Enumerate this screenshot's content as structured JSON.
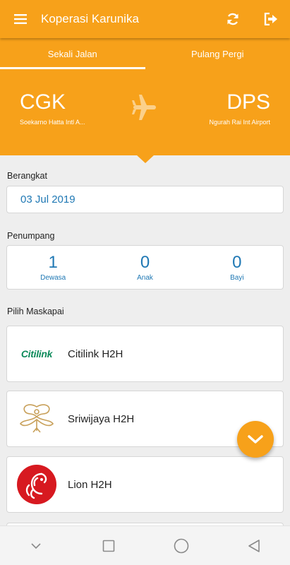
{
  "appbar": {
    "title": "Koperasi Karunika",
    "menu_icon": "hamburger-menu-icon",
    "refresh_icon": "refresh-icon",
    "logout_icon": "logout-icon"
  },
  "tabs": [
    {
      "label": "Sekali Jalan",
      "active": true
    },
    {
      "label": "Pulang Pergi",
      "active": false
    }
  ],
  "route": {
    "from_code": "CGK",
    "from_name": "Soekarno Hatta Intl A...",
    "to_code": "DPS",
    "to_name": "Ngurah Rai Int Airport",
    "plane_icon": "airplane-icon"
  },
  "departure": {
    "label": "Berangkat",
    "date": "03 Jul 2019"
  },
  "passengers": {
    "label": "Penumpang",
    "adult": {
      "count": "1",
      "caption": "Dewasa"
    },
    "child": {
      "count": "0",
      "caption": "Anak"
    },
    "infant": {
      "count": "0",
      "caption": "Bayi"
    }
  },
  "airlines": {
    "label": "Pilih Maskapai",
    "items": [
      {
        "name": "Citilink H2H",
        "logo_text": "Citilink"
      },
      {
        "name": "Sriwijaya H2H"
      },
      {
        "name": "Lion H2H"
      }
    ]
  },
  "colors": {
    "accent": "#f7a11a",
    "link": "#1f78b4",
    "citilink": "#0c8a5a",
    "sriwijaya": "#c8a05a",
    "lion": "#d71920"
  },
  "fab_icon": "chevron-down-icon",
  "system_nav": [
    "collapse-icon",
    "recents-icon",
    "home-icon",
    "back-icon"
  ]
}
